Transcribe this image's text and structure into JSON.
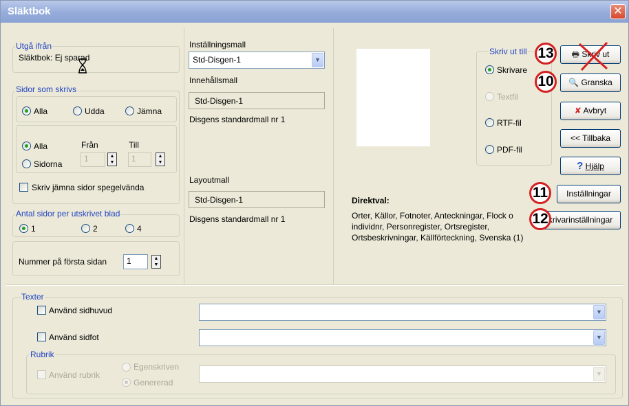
{
  "window": {
    "title": "Släktbok",
    "close_icon": "close-icon"
  },
  "source": {
    "legend": "Utgå ifrån",
    "value": "Släktbok: Ej sparad",
    "cursor_icon": "hourglass-icon"
  },
  "pages": {
    "legend": "Sidor som skrivs",
    "parity": {
      "all": "Alla",
      "odd": "Udda",
      "even": "Jämna",
      "selected": "all"
    },
    "range": {
      "all": "Alla",
      "pages": "Sidorna",
      "from_label": "Från",
      "to_label": "Till",
      "from_value": "1",
      "to_value": "1",
      "selected": "all"
    },
    "mirror_label": "Skriv jämna sidor spegelvända"
  },
  "per_sheet": {
    "legend": "Antal sidor per utskrivet blad",
    "options": [
      "1",
      "2",
      "4"
    ],
    "selected": "1"
  },
  "first_page": {
    "label": "Nummer på första sidan",
    "value": "1"
  },
  "templates": {
    "settings_label": "Inställningsmall",
    "settings_value": "Std-Disgen-1",
    "content_label": "Innehållsmall",
    "content_value": "Std-Disgen-1",
    "content_desc": "Disgens standardmall nr 1",
    "layout_label": "Layoutmall",
    "layout_value": "Std-Disgen-1",
    "layout_desc": "Disgens standardmall nr 1"
  },
  "output": {
    "legend": "Skriv ut till",
    "options": [
      "Skrivare",
      "Textfil",
      "RTF-fil",
      "PDF-fil"
    ],
    "selected": "Skrivare"
  },
  "direktval": {
    "heading": "Direktval:",
    "text": "Orter, Källor, Fotnoter, Anteckningar, Flock o individnr, Personregister, Ortsregister, Ortsbeskrivningar, Källförteckning, Svenska (1)"
  },
  "buttons": {
    "print": "Skriv ut",
    "preview": "Granska",
    "cancel": "Avbryt",
    "back": "<< Tillbaka",
    "help": "Hjälp",
    "settings": "Inställningar",
    "printer_settings": "Skrivarinställningar"
  },
  "callouts": {
    "print": "13",
    "preview": "10",
    "settings": "11",
    "printer_settings": "12"
  },
  "texts": {
    "legend": "Texter",
    "header_label": "Använd sidhuvud",
    "header_value": "",
    "footer_label": "Använd sidfot",
    "footer_value": "",
    "rubric": {
      "legend": "Rubrik",
      "use_label": "Använd rubrik",
      "custom_label": "Egenskriven",
      "generated_label": "Genererad",
      "selected": "Genererad",
      "value": ""
    }
  }
}
